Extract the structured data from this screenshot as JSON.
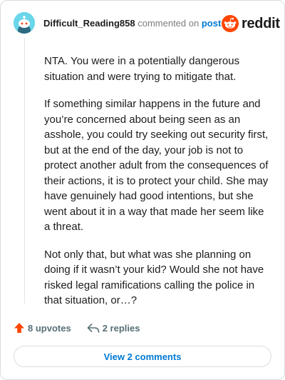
{
  "comment": {
    "username": "Difficult_Reading858",
    "meta_text": "commented on",
    "post_link": "post",
    "paragraphs": [
      "NTA. You were in a potentially dangerous situation and were trying to mitigate that.",
      "If something similar happens in the future and you’re concerned about being seen as an asshole, you could try seeking out security first, but at the end of the day, your job is not to protect another adult from the consequences of their actions, it is to protect your child. She may have genuinely had good intentions, but she went about it in a way that made her seem like a threat.",
      "Not only that, but what was she planning on doing if it wasn’t your kid? Would she not have risked legal ramifications calling the police in that situation, or…?"
    ]
  },
  "brand": {
    "wordmark": "reddit",
    "color": "#ff4500",
    "icon": "reddit-snoo-icon"
  },
  "avatar": {
    "icon": "snoo-avatar-icon",
    "color": "#6ad6ea"
  },
  "actions": {
    "upvotes": "8 upvotes",
    "replies": "2 replies",
    "upvote_icon": "upvote-arrow-icon",
    "upvote_color": "#ff4500",
    "reply_icon": "reply-arrow-icon"
  },
  "view_comments_label": "View 2 comments"
}
